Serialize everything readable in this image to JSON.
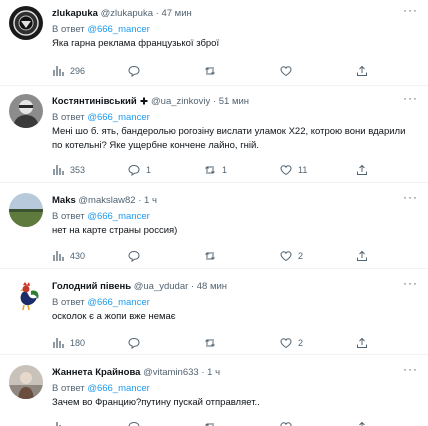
{
  "reply_prefix": "В ответ",
  "separator": "·",
  "more_glyph": "···",
  "colors": {
    "link": "#1d9bf0",
    "muted": "#536471",
    "text": "#0f1419",
    "divider": "#eff3f4"
  },
  "tweets": [
    {
      "name": "zlukapuka",
      "handle": "@zlukapuka",
      "time": "47 мин",
      "reply_to": "@666_mancer",
      "text": "Яка гарна реклама французької зброї",
      "views": "296",
      "replies": "",
      "retweets": "",
      "likes": ""
    },
    {
      "name": "Костянтинівський",
      "handle": "@ua_zinkoviy",
      "time": "51 мин",
      "reply_to": "@666_mancer",
      "text": "Мені шо б. ять, бандеролью рогозіну вислати уламок Х22, котрою вони вдарили по котельні? Яке ущербне кончене лайно, гній.",
      "views": "353",
      "replies": "1",
      "retweets": "1",
      "likes": "11"
    },
    {
      "name": "Maks",
      "handle": "@makslaw82",
      "time": "1 ч",
      "reply_to": "@666_mancer",
      "text": "нет на карте страны россия)",
      "views": "430",
      "replies": "",
      "retweets": "",
      "likes": "2"
    },
    {
      "name": "Голодний півень",
      "handle": "@ua_ydudar",
      "time": "48 мин",
      "reply_to": "@666_mancer",
      "text": "осколок є а жопи вже немає",
      "views": "180",
      "replies": "",
      "retweets": "",
      "likes": "2"
    },
    {
      "name": "Жаннета Крайнова",
      "handle": "@vitamin633",
      "time": "1 ч",
      "reply_to": "@666_mancer",
      "text": "Зачем во Францию?путину пускай отправляет..",
      "views": "",
      "replies": "",
      "retweets": "",
      "likes": ""
    }
  ]
}
